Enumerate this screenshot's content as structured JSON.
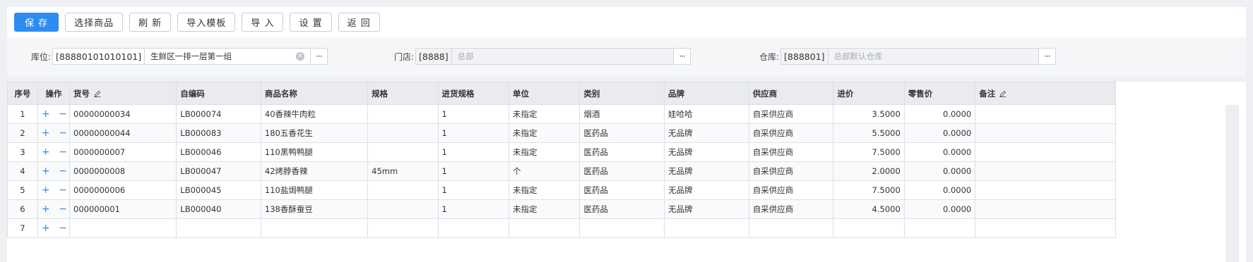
{
  "toolbar": {
    "save": "保 存",
    "select_goods": "选择商品",
    "refresh": "刷 新",
    "import_template": "导入模板",
    "import": "导 入",
    "settings": "设 置",
    "back": "返 回",
    "primary_color": "#2d8cf0"
  },
  "filters": {
    "location": {
      "label": "库位:",
      "code": "[88880101010101]",
      "name": "生鲜区一排一层第一组",
      "clear_icon": "clear-icon",
      "more": "···"
    },
    "store": {
      "label": "门店:",
      "code": "[8888]",
      "name": "总部",
      "more": "···"
    },
    "warehouse": {
      "label": "仓库:",
      "code": "[888801]",
      "name": "总部默认仓库",
      "more": "···"
    }
  },
  "table": {
    "columns": [
      "序号",
      "操作",
      "货号",
      "自编码",
      "商品名称",
      "规格",
      "进货规格",
      "单位",
      "类别",
      "品牌",
      "供应商",
      "进价",
      "零售价",
      "备注"
    ],
    "rows": [
      {
        "seq": "1",
        "op": "+ −",
        "sku": "00000000034",
        "code": "LB000074",
        "name": "40香辣牛肉粒",
        "spec": "",
        "pack": "1",
        "unit": "未指定",
        "category": "烟酒",
        "brand": "娃哈哈",
        "supplier": "自采供应商",
        "cost": "3.5000",
        "price": "0.0000",
        "note": ""
      },
      {
        "seq": "2",
        "op": "+ −",
        "sku": "00000000044",
        "code": "LB000083",
        "name": "180五香花生",
        "spec": "",
        "pack": "1",
        "unit": "未指定",
        "category": "医药品",
        "brand": "无品牌",
        "supplier": "自采供应商",
        "cost": "5.5000",
        "price": "0.0000",
        "note": ""
      },
      {
        "seq": "3",
        "op": "+ −",
        "sku": "0000000007",
        "code": "LB000046",
        "name": "110黑鸭鸭腿",
        "spec": "",
        "pack": "1",
        "unit": "未指定",
        "category": "医药品",
        "brand": "无品牌",
        "supplier": "自采供应商",
        "cost": "7.5000",
        "price": "0.0000",
        "note": ""
      },
      {
        "seq": "4",
        "op": "+ −",
        "sku": "0000000008",
        "code": "LB000047",
        "name": "42烤脖香辣",
        "spec": "45mm",
        "pack": "1",
        "unit": "个",
        "category": "医药品",
        "brand": "无品牌",
        "supplier": "自采供应商",
        "cost": "2.0000",
        "price": "0.0000",
        "note": ""
      },
      {
        "seq": "5",
        "op": "+ −",
        "sku": "0000000006",
        "code": "LB000045",
        "name": "110盐焗鸭腿",
        "spec": "",
        "pack": "1",
        "unit": "未指定",
        "category": "医药品",
        "brand": "无品牌",
        "supplier": "自采供应商",
        "cost": "7.5000",
        "price": "0.0000",
        "note": ""
      },
      {
        "seq": "6",
        "op": "+ −",
        "sku": "000000001",
        "code": "LB000040",
        "name": "138香酥蚕豆",
        "spec": "",
        "pack": "1",
        "unit": "未指定",
        "category": "医药品",
        "brand": "无品牌",
        "supplier": "自采供应商",
        "cost": "4.5000",
        "price": "0.0000",
        "note": ""
      },
      {
        "seq": "7",
        "op": "+ −",
        "sku": "",
        "code": "",
        "name": "",
        "spec": "",
        "pack": "",
        "unit": "",
        "category": "",
        "brand": "",
        "supplier": "",
        "cost": "",
        "price": "",
        "note": ""
      }
    ]
  }
}
